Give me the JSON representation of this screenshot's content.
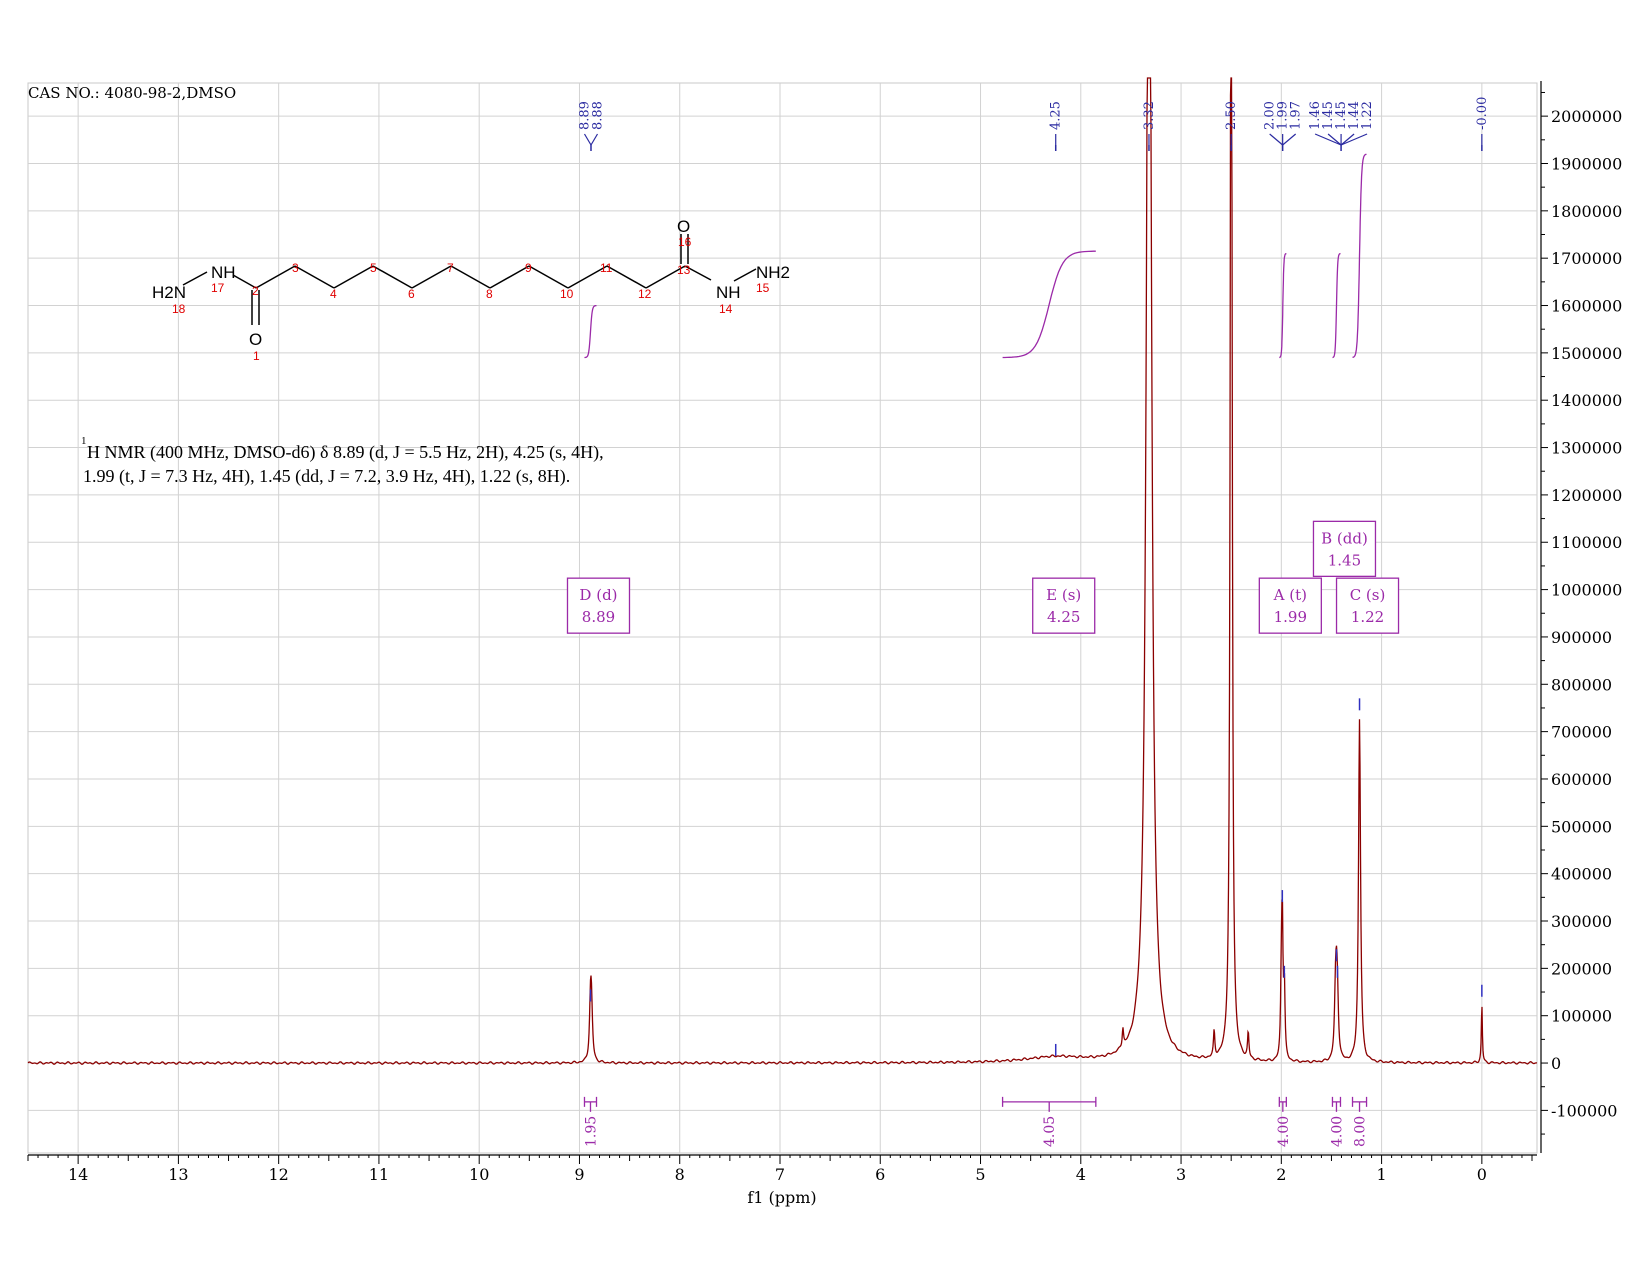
{
  "chart_data": {
    "type": "line",
    "title": "CAS NO.: 4080-98-2,DMSO",
    "xlabel": "f1 (ppm)",
    "ylabel": "",
    "xlim": [
      14.5,
      -0.55
    ],
    "ylim": [
      -190000,
      2070000
    ],
    "x_ticks": [
      14,
      13,
      12,
      11,
      10,
      9,
      8,
      7,
      6,
      5,
      4,
      3,
      2,
      1,
      0
    ],
    "x_tick_labels": [
      "14",
      "13",
      "12",
      "11",
      "10",
      "9",
      "8",
      "7",
      "6",
      "5",
      "4",
      "3",
      "2",
      "1",
      "0"
    ],
    "y_ticks": [
      2000000,
      1900000,
      1800000,
      1700000,
      1600000,
      1500000,
      1400000,
      1300000,
      1200000,
      1100000,
      1000000,
      900000,
      800000,
      700000,
      600000,
      500000,
      400000,
      300000,
      200000,
      100000,
      0,
      -100000
    ],
    "y_tick_labels": [
      "2000000",
      "1900000",
      "1800000",
      "1700000",
      "1600000",
      "1500000",
      "1400000",
      "1300000",
      "1200000",
      "1100000",
      "1000000",
      "900000",
      "800000",
      "700000",
      "600000",
      "500000",
      "400000",
      "300000",
      "200000",
      "100000",
      "0",
      "-100000"
    ],
    "grid": true,
    "spectrum_color": "#8b0000",
    "integral_color": "#9b2aa8",
    "peak_label_color": "#2a2aa0",
    "peaks": [
      {
        "ppm": 8.89,
        "height": 115000,
        "width": 0.012
      },
      {
        "ppm": 8.88,
        "height": 100000,
        "width": 0.012
      },
      {
        "ppm": 4.25,
        "height": 12000,
        "width": 0.35
      },
      {
        "ppm": 3.58,
        "height": 40000,
        "width": 0.008
      },
      {
        "ppm": 3.32,
        "height": 3000000,
        "width": 0.028
      },
      {
        "ppm": 2.67,
        "height": 55000,
        "width": 0.008
      },
      {
        "ppm": 2.5,
        "height": 3000000,
        "width": 0.01
      },
      {
        "ppm": 2.33,
        "height": 55000,
        "width": 0.008
      },
      {
        "ppm": 2.0,
        "height": 150000,
        "width": 0.008
      },
      {
        "ppm": 1.99,
        "height": 280000,
        "width": 0.008
      },
      {
        "ppm": 1.97,
        "height": 150000,
        "width": 0.008
      },
      {
        "ppm": 1.46,
        "height": 110000,
        "width": 0.012
      },
      {
        "ppm": 1.45,
        "height": 120000,
        "width": 0.012
      },
      {
        "ppm": 1.44,
        "height": 100000,
        "width": 0.012
      },
      {
        "ppm": 1.22,
        "height": 725000,
        "width": 0.012
      },
      {
        "ppm": 0.0,
        "height": 125000,
        "width": 0.006
      }
    ],
    "peak_labels_top": [
      {
        "ppms": [
          8.89,
          8.88
        ],
        "labels": [
          "8.89",
          "8.88"
        ]
      },
      {
        "ppms": [
          4.25
        ],
        "labels": [
          "4.25"
        ]
      },
      {
        "ppms": [
          3.32
        ],
        "labels": [
          "3.32"
        ]
      },
      {
        "ppms": [
          2.5
        ],
        "labels": [
          "2.50"
        ]
      },
      {
        "ppms": [
          2.0,
          1.99,
          1.97
        ],
        "labels": [
          "2.00",
          "1.99",
          "1.97"
        ]
      },
      {
        "ppms": [
          1.46,
          1.45,
          1.45,
          1.44,
          1.22
        ],
        "labels": [
          "1.46",
          "1.45",
          "1.45",
          "1.44",
          "1.22"
        ]
      },
      {
        "ppms": [
          0.0
        ],
        "labels": [
          "-0.00"
        ]
      }
    ],
    "multiplets": [
      {
        "label": "D (d)",
        "shift": "8.89",
        "ppm": 8.89,
        "box_y": 965000
      },
      {
        "label": "E (s)",
        "shift": "4.25",
        "ppm": 4.25,
        "box_y": 965000
      },
      {
        "label": "A (t)",
        "shift": "1.99",
        "ppm": 1.99,
        "box_y": 965000
      },
      {
        "label": "B (dd)",
        "shift": "1.45",
        "ppm": 1.45,
        "box_y": 1085000
      },
      {
        "label": "C (s)",
        "shift": "1.22",
        "ppm": 1.22,
        "box_y": 965000
      }
    ],
    "integrals": [
      {
        "from": 8.95,
        "to": 8.83,
        "value": "1.95",
        "curve_start": 1490000,
        "curve_end": 1600000
      },
      {
        "from": 4.78,
        "to": 3.85,
        "value": "4.05",
        "curve_start": 1490000,
        "curve_end": 1715000
      },
      {
        "from": 2.02,
        "to": 1.95,
        "value": "4.00",
        "curve_start": 1490000,
        "curve_end": 1710000
      },
      {
        "from": 1.49,
        "to": 1.41,
        "value": "4.00",
        "curve_start": 1490000,
        "curve_end": 1710000
      },
      {
        "from": 1.29,
        "to": 1.15,
        "value": "8.00",
        "curve_start": 1490000,
        "curve_end": 1920000
      }
    ]
  },
  "structure": {
    "atoms": [
      "H2N",
      "18",
      "NH",
      "17",
      "2",
      "O",
      "1",
      "3",
      "4",
      "5",
      "6",
      "7",
      "8",
      "9",
      "10",
      "11",
      "12",
      "13",
      "O",
      "16",
      "NH",
      "14",
      "NH2",
      "15"
    ]
  },
  "description": {
    "line1": "H NMR (400 MHz, DMSO-d6) δ 8.89 (d, J = 5.5 Hz, 2H), 4.25 (s, 4H),",
    "line2": "1.99 (t, J = 7.3 Hz, 4H), 1.45 (dd, J = 7.2, 3.9 Hz, 4H), 1.22 (s, 8H).",
    "superscript": "1",
    "subscript": "6"
  }
}
